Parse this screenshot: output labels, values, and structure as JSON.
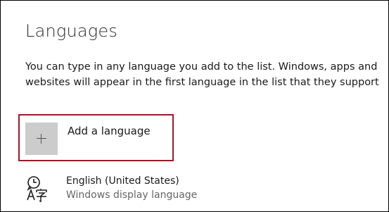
{
  "section": {
    "title": "Languages",
    "description": "You can type in any language you add to the list. Windows, apps and websites will appear in the first language in the list that they support"
  },
  "add_language": {
    "label": "Add a language",
    "icon": "plus-icon"
  },
  "languages": [
    {
      "name": "English (United States)",
      "subtitle": "Windows display language",
      "icon": "language-display-icon"
    }
  ],
  "colors": {
    "highlight_border": "#9b1c25",
    "plus_background": "#cccccc"
  }
}
